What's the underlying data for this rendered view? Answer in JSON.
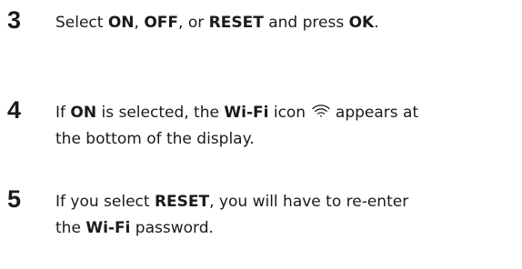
{
  "steps": [
    {
      "number": "3",
      "parts": [
        "Select ",
        "ON",
        ", ",
        "OFF",
        ", or ",
        "RESET",
        " and press ",
        "OK",
        "."
      ]
    },
    {
      "number": "4",
      "parts": [
        "If ",
        "ON",
        " is selected, the ",
        "Wi-Fi",
        " icon ",
        " appears at",
        "the bottom of the display."
      ],
      "icon": "wifi-icon"
    },
    {
      "number": "5",
      "parts": [
        "If you select ",
        "RESET",
        ", you will have to re-enter",
        "the ",
        "Wi-Fi",
        " password."
      ]
    }
  ]
}
